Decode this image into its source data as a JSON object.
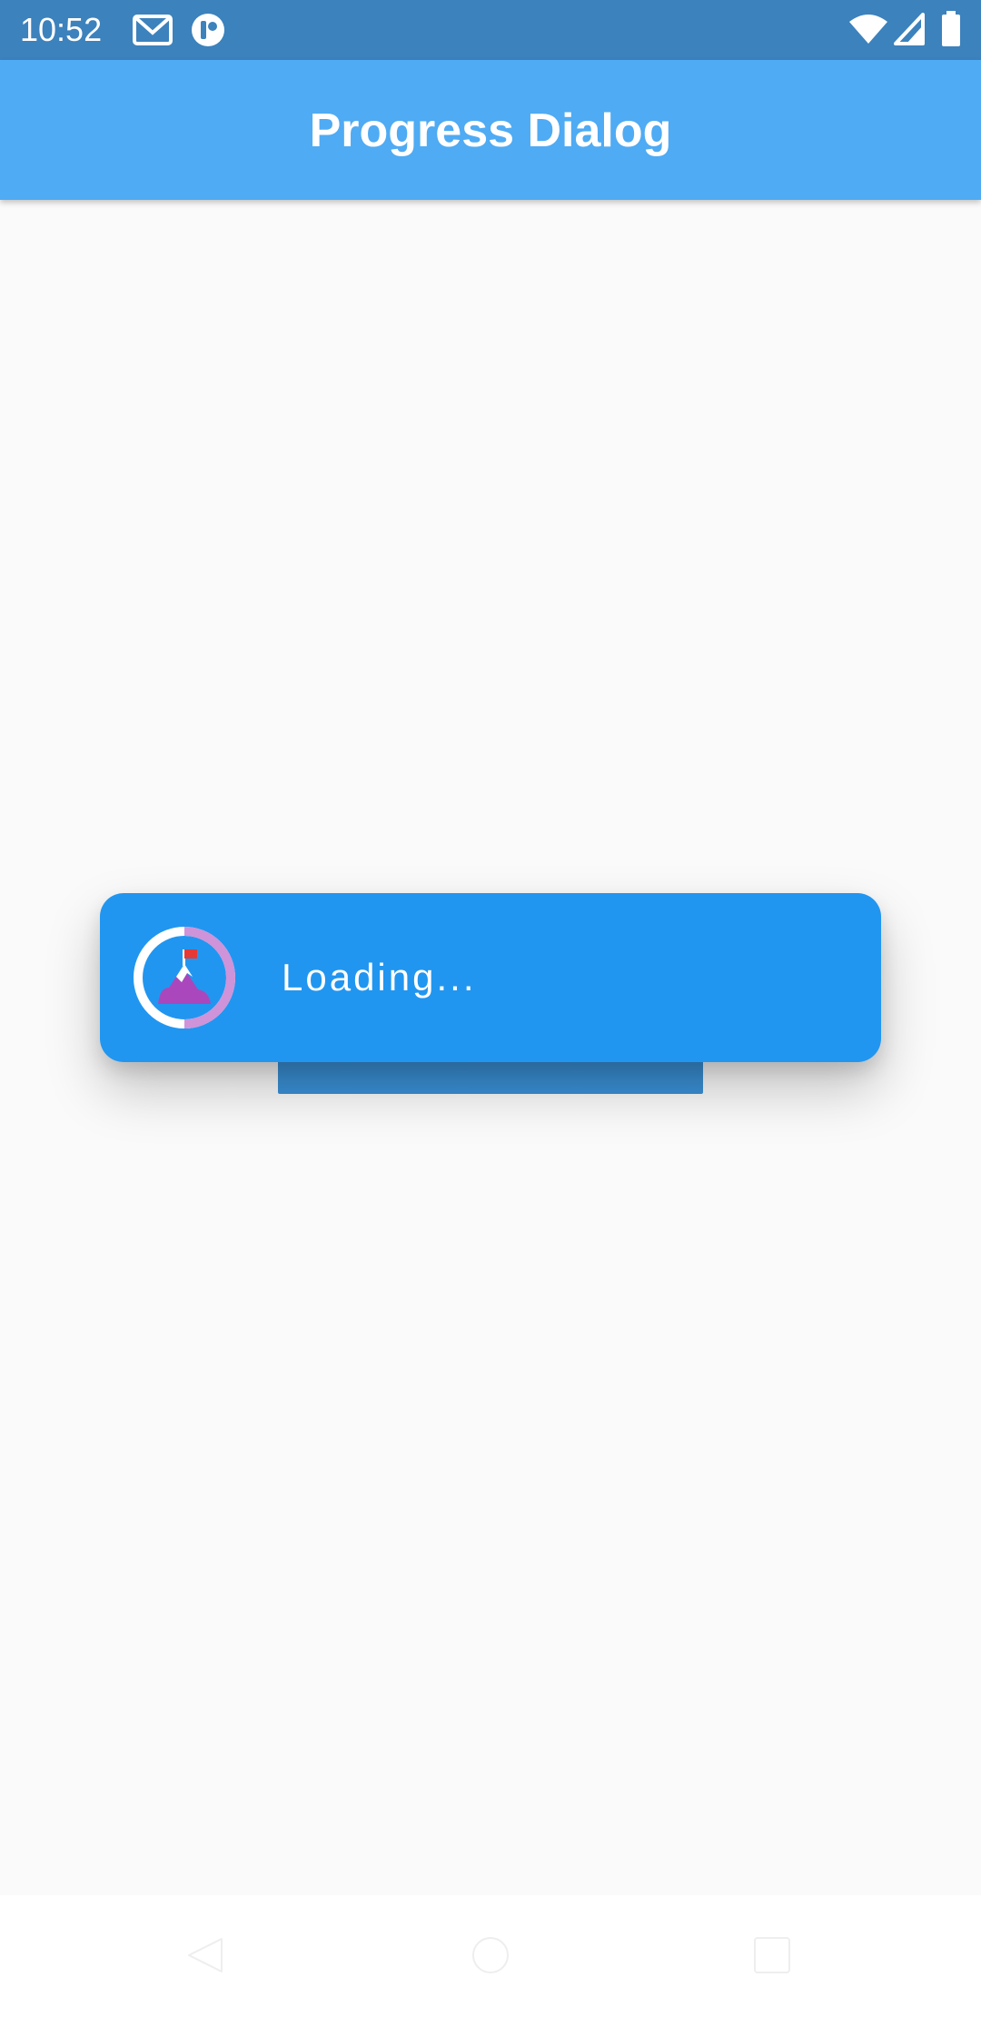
{
  "status_bar": {
    "time": "10:52",
    "icons": [
      "gmail-icon",
      "app-notification-icon",
      "wifi-icon",
      "signal-icon",
      "battery-icon"
    ]
  },
  "app_bar": {
    "title": "Progress Dialog"
  },
  "dialog": {
    "message": "Loading...",
    "icon": "mountain-flag-progress-icon"
  },
  "nav_bar": {
    "icons": [
      "back-icon",
      "home-icon",
      "recents-icon"
    ]
  },
  "colors": {
    "status_bar": "#3c82bd",
    "app_bar": "#4fabf3",
    "dialog": "#2196f0",
    "background": "#fafafa"
  }
}
